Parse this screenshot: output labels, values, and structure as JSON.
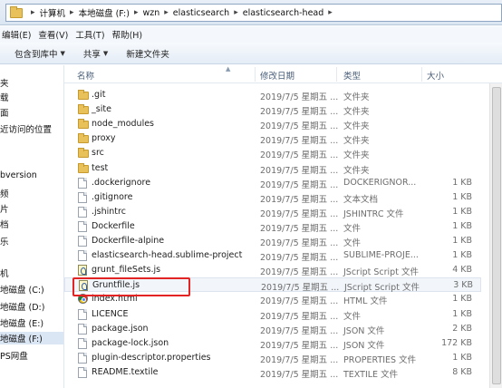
{
  "address": {
    "crumbs": [
      "计算机",
      "本地磁盘 (F:)",
      "wzn",
      "elasticsearch",
      "elasticsearch-head"
    ]
  },
  "menu": [
    "编辑(E)",
    "查看(V)",
    "工具(T)",
    "帮助(H)"
  ],
  "toolbar": {
    "include_in_library": "包含到库中",
    "share": "共享",
    "new_folder": "新建文件夹"
  },
  "nav": [
    "夹",
    "载",
    "面",
    "近访问的位置",
    "bversion",
    "频",
    "片",
    "档",
    "乐",
    "机",
    "地磁盘 (C:)",
    "地磁盘 (D:)",
    "地磁盘 (E:)",
    "地磁盘 (F:)",
    "PS网盘"
  ],
  "columns": {
    "name": "名称",
    "modified": "修改日期",
    "type": "类型",
    "size": "大小"
  },
  "files": [
    {
      "name": ".git",
      "date": "2019/7/5 星期五 ...",
      "type": "文件夹",
      "size": "",
      "icon": "folder-icon"
    },
    {
      "name": "_site",
      "date": "2019/7/5 星期五 ...",
      "type": "文件夹",
      "size": "",
      "icon": "folder-icon"
    },
    {
      "name": "node_modules",
      "date": "2019/7/5 星期五 ...",
      "type": "文件夹",
      "size": "",
      "icon": "folder-icon"
    },
    {
      "name": "proxy",
      "date": "2019/7/5 星期五 ...",
      "type": "文件夹",
      "size": "",
      "icon": "folder-icon"
    },
    {
      "name": "src",
      "date": "2019/7/5 星期五 ...",
      "type": "文件夹",
      "size": "",
      "icon": "folder-icon"
    },
    {
      "name": "test",
      "date": "2019/7/5 星期五 ...",
      "type": "文件夹",
      "size": "",
      "icon": "folder-icon"
    },
    {
      "name": ".dockerignore",
      "date": "2019/7/5 星期五 ...",
      "type": "DOCKERIGNOR...",
      "size": "1 KB",
      "icon": "file-icon"
    },
    {
      "name": ".gitignore",
      "date": "2019/7/5 星期五 ...",
      "type": "文本文档",
      "size": "1 KB",
      "icon": "file-icon"
    },
    {
      "name": ".jshintrc",
      "date": "2019/7/5 星期五 ...",
      "type": "JSHINTRC 文件",
      "size": "1 KB",
      "icon": "file-icon"
    },
    {
      "name": "Dockerfile",
      "date": "2019/7/5 星期五 ...",
      "type": "文件",
      "size": "1 KB",
      "icon": "file-icon"
    },
    {
      "name": "Dockerfile-alpine",
      "date": "2019/7/5 星期五 ...",
      "type": "文件",
      "size": "1 KB",
      "icon": "file-icon"
    },
    {
      "name": "elasticsearch-head.sublime-project",
      "date": "2019/7/5 星期五 ...",
      "type": "SUBLIME-PROJE...",
      "size": "1 KB",
      "icon": "file-icon"
    },
    {
      "name": "grunt_fileSets.js",
      "date": "2019/7/5 星期五 ...",
      "type": "JScript Script 文件",
      "size": "4 KB",
      "icon": "js-file-icon"
    },
    {
      "name": "Gruntfile.js",
      "date": "2019/7/5 星期五 ...",
      "type": "JScript Script 文件",
      "size": "3 KB",
      "icon": "js-file-icon"
    },
    {
      "name": "index.html",
      "date": "2019/7/5 星期五 ...",
      "type": "HTML 文件",
      "size": "1 KB",
      "icon": "chrome-icon"
    },
    {
      "name": "LICENCE",
      "date": "2019/7/5 星期五 ...",
      "type": "文件",
      "size": "1 KB",
      "icon": "file-icon"
    },
    {
      "name": "package.json",
      "date": "2019/7/5 星期五 ...",
      "type": "JSON 文件",
      "size": "2 KB",
      "icon": "file-icon"
    },
    {
      "name": "package-lock.json",
      "date": "2019/7/5 星期五 ...",
      "type": "JSON 文件",
      "size": "172 KB",
      "icon": "file-icon"
    },
    {
      "name": "plugin-descriptor.properties",
      "date": "2019/7/5 星期五 ...",
      "type": "PROPERTIES 文件",
      "size": "1 KB",
      "icon": "file-icon"
    },
    {
      "name": "README.textile",
      "date": "2019/7/5 星期五 ...",
      "type": "TEXTILE 文件",
      "size": "8 KB",
      "icon": "file-icon"
    }
  ],
  "colors": {
    "highlight_border": "#e32424",
    "selection": "#dbe6f5"
  }
}
